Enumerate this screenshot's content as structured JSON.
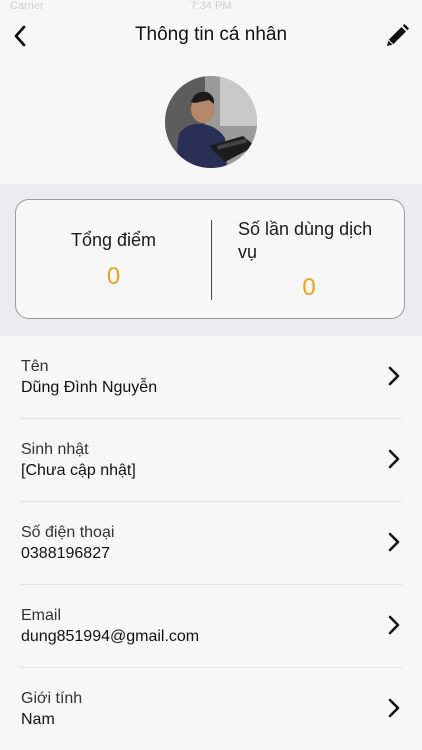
{
  "status_bar": {
    "carrier": "Carrier",
    "time": "7:34 PM"
  },
  "header": {
    "title": "Thông tin cá nhân"
  },
  "avatar": {
    "icon": "user-photo"
  },
  "stats": {
    "total_points_label": "Tổng điểm",
    "total_points_value": "0",
    "usage_count_label": "Số lần dùng dịch vụ",
    "usage_count_value": "0"
  },
  "colors": {
    "accent": "#e8a320",
    "background": "#f7f7f7",
    "section": "#ececef"
  },
  "fields": [
    {
      "label": "Tên",
      "value": "Dũng Đình Nguyễn"
    },
    {
      "label": "Sinh nhật",
      "value": "[Chưa cập nhật]"
    },
    {
      "label": "Số điện thoại",
      "value": "0388196827"
    },
    {
      "label": "Email",
      "value": "dung851994@gmail.com"
    },
    {
      "label": "Giới tính",
      "value": "Nam"
    }
  ]
}
